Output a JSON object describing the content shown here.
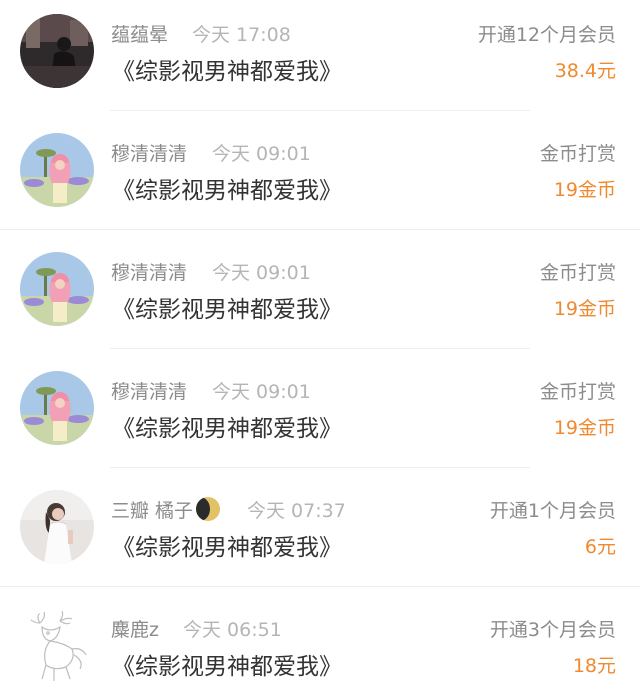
{
  "orders": [
    {
      "user": "蕴蕴晕",
      "time": "今天 17:08",
      "title": "《综影视男神都爱我》",
      "action": "开通12个月会员",
      "amount": "38.4元",
      "avatar": "dark-portrait-avatar"
    },
    {
      "user": "穆清清清",
      "time": "今天 09:01",
      "title": "《综影视男神都爱我》",
      "action": "金币打赏",
      "amount": "19金币",
      "avatar": "pink-hair-girl-avatar"
    },
    {
      "user": "穆清清清",
      "time": "今天 09:01",
      "title": "《综影视男神都爱我》",
      "action": "金币打赏",
      "amount": "19金币",
      "avatar": "pink-hair-girl-avatar"
    },
    {
      "user": "穆清清清",
      "time": "今天 09:01",
      "title": "《综影视男神都爱我》",
      "action": "金币打赏",
      "amount": "19金币",
      "avatar": "pink-hair-girl-avatar"
    },
    {
      "user": "三瓣 橘子",
      "user_icon": "moon-icon",
      "time": "今天 07:37",
      "title": "《综影视男神都爱我》",
      "action": "开通1个月会员",
      "amount": "6元",
      "avatar": "white-dress-girl-avatar"
    },
    {
      "user": "麋鹿z",
      "time": "今天 06:51",
      "title": "《综影视男神都爱我》",
      "action": "开通3个月会员",
      "amount": "18元",
      "avatar": "deer-sketch-avatar"
    }
  ],
  "colors": {
    "amount": "#f08a2e",
    "name": "#8c8c8c",
    "time": "#b5b5b5",
    "title": "#333333",
    "divider": "#eeeeee"
  }
}
